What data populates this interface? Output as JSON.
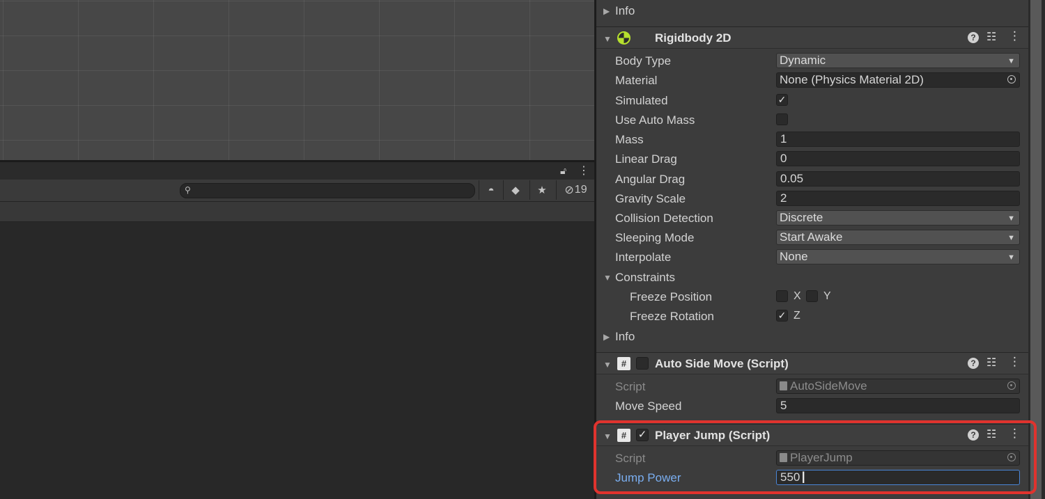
{
  "left_panel": {
    "hidden_count": "19",
    "search": {
      "value": "",
      "placeholder": ""
    }
  },
  "inspector": {
    "info_top": "Info",
    "rigidbody": {
      "title": "Rigidbody 2D",
      "icon": "rigidbody-2d-icon",
      "fields": {
        "body_type": {
          "label": "Body Type",
          "value": "Dynamic"
        },
        "material": {
          "label": "Material",
          "value": "None (Physics Material 2D)"
        },
        "simulated": {
          "label": "Simulated",
          "checked": true
        },
        "use_auto_mass": {
          "label": "Use Auto Mass",
          "checked": false
        },
        "mass": {
          "label": "Mass",
          "value": "1"
        },
        "linear_drag": {
          "label": "Linear Drag",
          "value": "0"
        },
        "angular_drag": {
          "label": "Angular Drag",
          "value": "0.05"
        },
        "gravity_scale": {
          "label": "Gravity Scale",
          "value": "2"
        },
        "collision_detection": {
          "label": "Collision Detection",
          "value": "Discrete"
        },
        "sleeping_mode": {
          "label": "Sleeping Mode",
          "value": "Start Awake"
        },
        "interpolate": {
          "label": "Interpolate",
          "value": "None"
        },
        "constraints": {
          "label": "Constraints",
          "freeze_position": {
            "label": "Freeze Position",
            "x_label": "X",
            "y_label": "Y",
            "x": false,
            "y": false
          },
          "freeze_rotation": {
            "label": "Freeze Rotation",
            "z_label": "Z",
            "z": true
          }
        }
      },
      "info": "Info"
    },
    "auto_side_move": {
      "title": "Auto Side Move (Script)",
      "enabled": false,
      "script_label": "Script",
      "script_value": "AutoSideMove",
      "move_speed_label": "Move Speed",
      "move_speed_value": "5"
    },
    "player_jump": {
      "title": "Player Jump (Script)",
      "enabled": true,
      "script_label": "Script",
      "script_value": "PlayerJump",
      "jump_power_label": "Jump Power",
      "jump_power_value": "550"
    }
  },
  "colors": {
    "highlight": "#e0332e",
    "focus": "#4a86d8",
    "rigidbody_icon": "#b6e02e"
  }
}
